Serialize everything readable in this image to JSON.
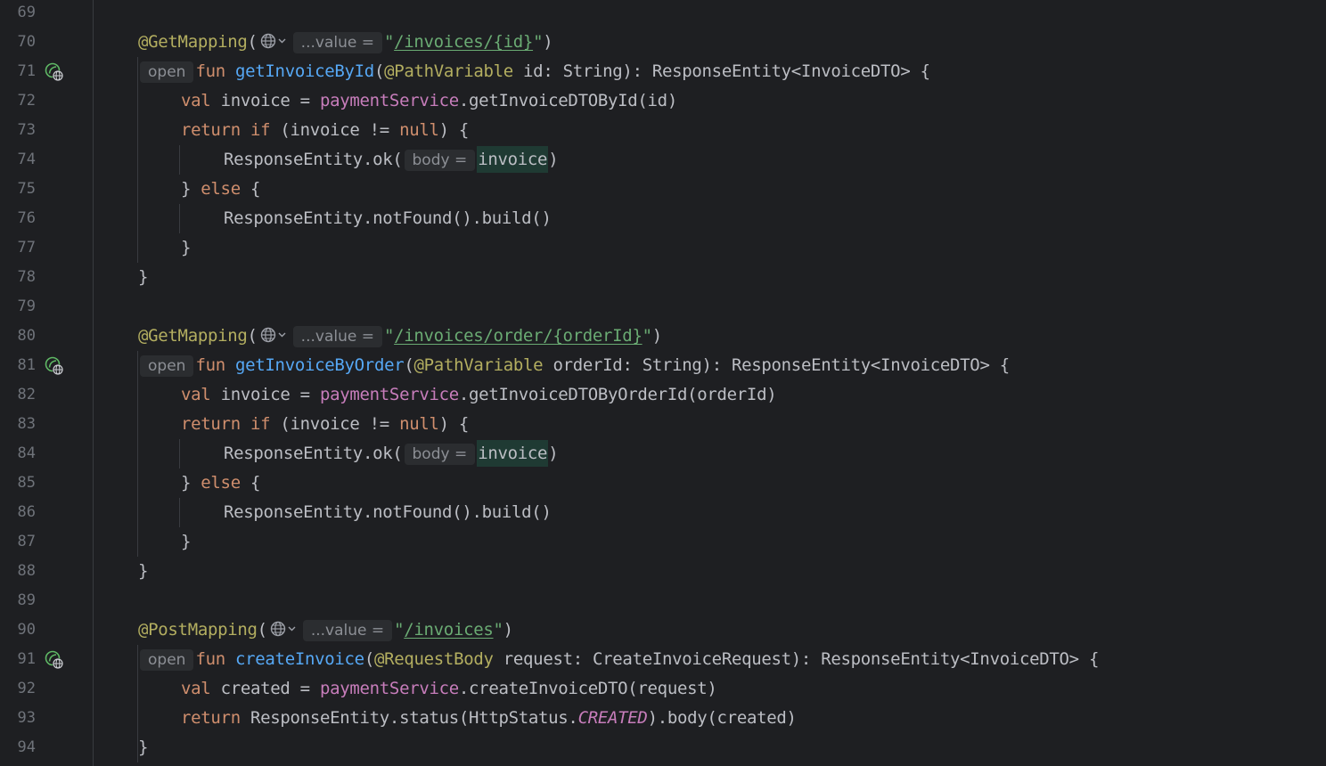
{
  "lines": [
    {
      "num": "69",
      "gutter_icon": null,
      "indent": 0,
      "tokens": []
    },
    {
      "num": "70",
      "gutter_icon": null,
      "indent": 0,
      "tokens": [
        {
          "t": "ann",
          "v": "@GetMapping"
        },
        {
          "t": "plain",
          "v": "("
        },
        {
          "t": "globe",
          "v": "globe-icon"
        },
        {
          "t": "hint",
          "v": "...value ="
        },
        {
          "t": "str",
          "v": "\""
        },
        {
          "t": "url",
          "v": "/invoices/{id}"
        },
        {
          "t": "str",
          "v": "\""
        },
        {
          "t": "plain",
          "v": ")"
        }
      ]
    },
    {
      "num": "71",
      "gutter_icon": "endpoint-icon",
      "indent": 0,
      "tokens": [
        {
          "t": "hint",
          "v": "open"
        },
        {
          "t": "kw",
          "v": "fun "
        },
        {
          "t": "fn",
          "v": "getInvoiceById"
        },
        {
          "t": "plain",
          "v": "("
        },
        {
          "t": "ann",
          "v": "@PathVariable"
        },
        {
          "t": "plain",
          "v": " id: String): ResponseEntity<InvoiceDTO> {"
        }
      ]
    },
    {
      "num": "72",
      "gutter_icon": null,
      "indent": 1,
      "tokens": [
        {
          "t": "kw",
          "v": "val "
        },
        {
          "t": "plain",
          "v": "invoice = "
        },
        {
          "t": "prop",
          "v": "paymentService"
        },
        {
          "t": "plain",
          "v": ".getInvoiceDTOById(id)"
        }
      ]
    },
    {
      "num": "73",
      "gutter_icon": null,
      "indent": 1,
      "tokens": [
        {
          "t": "kw",
          "v": "return if "
        },
        {
          "t": "plain",
          "v": "(invoice != "
        },
        {
          "t": "kw",
          "v": "null"
        },
        {
          "t": "plain",
          "v": ") {"
        }
      ]
    },
    {
      "num": "74",
      "gutter_icon": null,
      "indent": 2,
      "tokens": [
        {
          "t": "plain",
          "v": "ResponseEntity.ok("
        },
        {
          "t": "hint",
          "v": "body ="
        },
        {
          "t": "hl",
          "v": "invoice"
        },
        {
          "t": "plain",
          "v": ")"
        }
      ]
    },
    {
      "num": "75",
      "gutter_icon": null,
      "indent": 1,
      "tokens": [
        {
          "t": "plain",
          "v": "} "
        },
        {
          "t": "kw",
          "v": "else "
        },
        {
          "t": "plain",
          "v": "{"
        }
      ]
    },
    {
      "num": "76",
      "gutter_icon": null,
      "indent": 2,
      "tokens": [
        {
          "t": "plain",
          "v": "ResponseEntity.notFound().build()"
        }
      ]
    },
    {
      "num": "77",
      "gutter_icon": null,
      "indent": 1,
      "tokens": [
        {
          "t": "plain",
          "v": "}"
        }
      ]
    },
    {
      "num": "78",
      "gutter_icon": null,
      "indent": 0,
      "tokens": [
        {
          "t": "plain",
          "v": "}"
        }
      ]
    },
    {
      "num": "79",
      "gutter_icon": null,
      "indent": 0,
      "tokens": []
    },
    {
      "num": "80",
      "gutter_icon": null,
      "indent": 0,
      "tokens": [
        {
          "t": "ann",
          "v": "@GetMapping"
        },
        {
          "t": "plain",
          "v": "("
        },
        {
          "t": "globe",
          "v": "globe-icon"
        },
        {
          "t": "hint",
          "v": "...value ="
        },
        {
          "t": "str",
          "v": "\""
        },
        {
          "t": "url",
          "v": "/invoices/order/{orderId}"
        },
        {
          "t": "str",
          "v": "\""
        },
        {
          "t": "plain",
          "v": ")"
        }
      ]
    },
    {
      "num": "81",
      "gutter_icon": "endpoint-icon",
      "indent": 0,
      "tokens": [
        {
          "t": "hint",
          "v": "open"
        },
        {
          "t": "kw",
          "v": "fun "
        },
        {
          "t": "fn",
          "v": "getInvoiceByOrder"
        },
        {
          "t": "plain",
          "v": "("
        },
        {
          "t": "ann",
          "v": "@PathVariable"
        },
        {
          "t": "plain",
          "v": " orderId: String): ResponseEntity<InvoiceDTO> {"
        }
      ]
    },
    {
      "num": "82",
      "gutter_icon": null,
      "indent": 1,
      "tokens": [
        {
          "t": "kw",
          "v": "val "
        },
        {
          "t": "plain",
          "v": "invoice = "
        },
        {
          "t": "prop",
          "v": "paymentService"
        },
        {
          "t": "plain",
          "v": ".getInvoiceDTOByOrderId(orderId)"
        }
      ]
    },
    {
      "num": "83",
      "gutter_icon": null,
      "indent": 1,
      "tokens": [
        {
          "t": "kw",
          "v": "return if "
        },
        {
          "t": "plain",
          "v": "(invoice != "
        },
        {
          "t": "kw",
          "v": "null"
        },
        {
          "t": "plain",
          "v": ") {"
        }
      ]
    },
    {
      "num": "84",
      "gutter_icon": null,
      "indent": 2,
      "tokens": [
        {
          "t": "plain",
          "v": "ResponseEntity.ok("
        },
        {
          "t": "hint",
          "v": "body ="
        },
        {
          "t": "hl",
          "v": "invoice"
        },
        {
          "t": "plain",
          "v": ")"
        }
      ]
    },
    {
      "num": "85",
      "gutter_icon": null,
      "indent": 1,
      "tokens": [
        {
          "t": "plain",
          "v": "} "
        },
        {
          "t": "kw",
          "v": "else "
        },
        {
          "t": "plain",
          "v": "{"
        }
      ]
    },
    {
      "num": "86",
      "gutter_icon": null,
      "indent": 2,
      "tokens": [
        {
          "t": "plain",
          "v": "ResponseEntity.notFound().build()"
        }
      ]
    },
    {
      "num": "87",
      "gutter_icon": null,
      "indent": 1,
      "tokens": [
        {
          "t": "plain",
          "v": "}"
        }
      ]
    },
    {
      "num": "88",
      "gutter_icon": null,
      "indent": 0,
      "tokens": [
        {
          "t": "plain",
          "v": "}"
        }
      ]
    },
    {
      "num": "89",
      "gutter_icon": null,
      "indent": 0,
      "tokens": []
    },
    {
      "num": "90",
      "gutter_icon": null,
      "indent": 0,
      "tokens": [
        {
          "t": "ann",
          "v": "@PostMapping"
        },
        {
          "t": "plain",
          "v": "("
        },
        {
          "t": "globe",
          "v": "globe-icon"
        },
        {
          "t": "hint",
          "v": "...value ="
        },
        {
          "t": "str",
          "v": "\""
        },
        {
          "t": "url",
          "v": "/invoices"
        },
        {
          "t": "str",
          "v": "\""
        },
        {
          "t": "plain",
          "v": ")"
        }
      ]
    },
    {
      "num": "91",
      "gutter_icon": "endpoint-icon",
      "indent": 0,
      "tokens": [
        {
          "t": "hint",
          "v": "open"
        },
        {
          "t": "kw",
          "v": "fun "
        },
        {
          "t": "fn",
          "v": "createInvoice"
        },
        {
          "t": "plain",
          "v": "("
        },
        {
          "t": "ann",
          "v": "@RequestBody"
        },
        {
          "t": "plain",
          "v": " request: CreateInvoiceRequest): ResponseEntity<InvoiceDTO> {"
        }
      ]
    },
    {
      "num": "92",
      "gutter_icon": null,
      "indent": 1,
      "tokens": [
        {
          "t": "kw",
          "v": "val "
        },
        {
          "t": "plain",
          "v": "created = "
        },
        {
          "t": "prop",
          "v": "paymentService"
        },
        {
          "t": "plain",
          "v": ".createInvoiceDTO(request)"
        }
      ]
    },
    {
      "num": "93",
      "gutter_icon": null,
      "indent": 1,
      "tokens": [
        {
          "t": "kw",
          "v": "return "
        },
        {
          "t": "plain",
          "v": "ResponseEntity.status(HttpStatus."
        },
        {
          "t": "const",
          "v": "CREATED"
        },
        {
          "t": "plain",
          "v": ").body(created)"
        }
      ]
    },
    {
      "num": "94",
      "gutter_icon": null,
      "indent": 0,
      "tokens": [
        {
          "t": "plain",
          "v": "}"
        }
      ]
    }
  ],
  "colors": {
    "background": "#1e1f22",
    "keyword": "#cf8e6d",
    "annotation": "#b3ae60",
    "function": "#56a8f5",
    "string": "#6aab73",
    "property": "#c77dbb",
    "text": "#bcbec4",
    "line_number": "#6f737a",
    "hint_bg": "#2b2d30",
    "hint_text": "#8c8f95",
    "highlight_bg": "#1f3a33"
  }
}
